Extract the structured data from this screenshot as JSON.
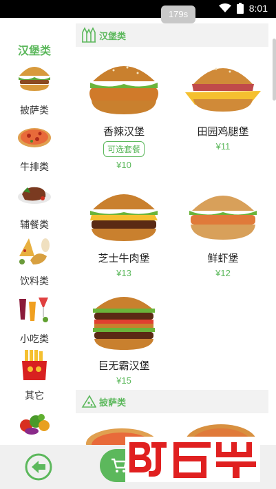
{
  "status_bar": {
    "time": "8:01",
    "icons": [
      "wifi-icon",
      "battery-icon"
    ]
  },
  "timer": "179s",
  "categories": [
    {
      "label": "汉堡类",
      "icon": "burger-icon",
      "active": true
    },
    {
      "label": "披萨类",
      "icon": "pizza-icon",
      "active": false
    },
    {
      "label": "牛排类",
      "icon": "steak-icon",
      "active": false
    },
    {
      "label": "辅餐类",
      "icon": "side-dish-icon",
      "active": false
    },
    {
      "label": "饮料类",
      "icon": "drinks-icon",
      "active": false
    },
    {
      "label": "小吃类",
      "icon": "fries-icon",
      "active": false
    },
    {
      "label": "其它",
      "icon": "vegetables-icon",
      "active": false
    }
  ],
  "sections": [
    {
      "title": "汉堡类",
      "icon": "burger-section-icon"
    },
    {
      "title": "披萨类",
      "icon": "pizza-section-icon"
    }
  ],
  "items": [
    {
      "name": "香辣汉堡",
      "price": "¥10",
      "badge": "可选套餐"
    },
    {
      "name": "田园鸡腿堡",
      "price": "¥11"
    },
    {
      "name": "芝士牛肉堡",
      "price": "¥13"
    },
    {
      "name": "鲜虾堡",
      "price": "¥12"
    },
    {
      "name": "巨无霸汉堡",
      "price": "¥15"
    }
  ],
  "bottom_bar": {
    "back_icon": "back-arrow-icon",
    "cart_icon": "cart-icon"
  },
  "colors": {
    "accent": "#5cb85c",
    "header_bg": "#f2f2f2",
    "timer_bg": "#c8c8c8",
    "watermark": "#e02020"
  }
}
